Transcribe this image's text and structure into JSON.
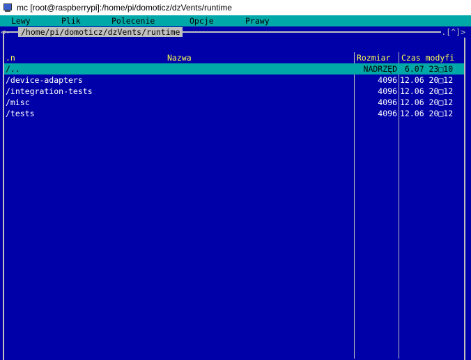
{
  "window": {
    "title": "mc [root@raspberrypi]:/home/pi/domoticz/dzVents/runtime",
    "icon": "putty-terminal-icon"
  },
  "menu": {
    "items": [
      "Lewy",
      "Plik",
      "Polecenie",
      "Opcje",
      "Prawy"
    ]
  },
  "panel": {
    "frame_left": "<-",
    "path": "/home/pi/domoticz/dzVents/runtime",
    "frame_right": ".[^]>",
    "header": {
      "sort": ".n",
      "name": "Nazwa",
      "size": "Rozmiar",
      "time": "Czas modyfi"
    },
    "rows": [
      {
        "name": "/..",
        "size": "NADRZĘD",
        "time": " 6.07 23□10",
        "selected": true
      },
      {
        "name": "/device-adapters",
        "size": "4096",
        "time": "12.06 20□12",
        "selected": false
      },
      {
        "name": "/integration-tests",
        "size": "4096",
        "time": "12.06 20□12",
        "selected": false
      },
      {
        "name": "/misc",
        "size": "4096",
        "time": "12.06 20□12",
        "selected": false
      },
      {
        "name": "/tests",
        "size": "4096",
        "time": "12.06 20□12",
        "selected": false
      }
    ]
  },
  "colors": {
    "background": "#0000a8",
    "menu_bg": "#00a8a8",
    "header_text": "#ffff54",
    "frame": "#c0c0c0"
  }
}
